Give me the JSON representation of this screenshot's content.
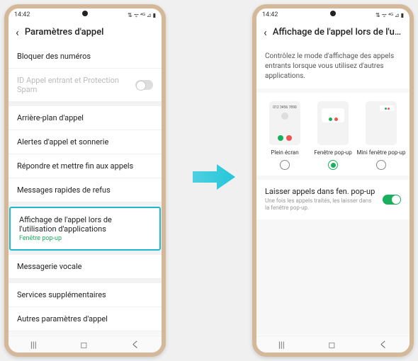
{
  "status": {
    "time": "14:42",
    "icons": "⚙ ◎ ✧ ⋯",
    "right": "⇅ ᯤ ⁴ᴳ  ⊿ ▮"
  },
  "left": {
    "title": "Paramètres d'appel",
    "items": {
      "block": "Bloquer des numéros",
      "caller_id": "ID Appel entrant et Protection Spam",
      "bg": "Arrière-plan d'appel",
      "alerts": "Alertes d'appel et sonnerie",
      "answer": "Répondre et mettre fin aux appels",
      "quick": "Messages rapides de refus",
      "display_title": "Affichage de l'appel lors de l'utilisation d'applications",
      "display_sub": "Fenêtre pop-up",
      "voicemail": "Messagerie vocale",
      "supp": "Services supplémentaires",
      "other": "Autres paramètres d'appel"
    }
  },
  "right": {
    "title": "Affichage de l'appel lors de l'utilisa...",
    "desc": "Contrôlez le mode d'affichage des appels entrants lorsque vous utilisez d'autres applications.",
    "preview_number": "012 3456 7890",
    "opts": {
      "full": "Plein écran",
      "popup": "Fenêtre pop-up",
      "mini": "Mini fenêtre pop-up"
    },
    "keep": {
      "title": "Laisser appels dans fen. pop-up",
      "sub": "Une fois les appels traités, les laisser dans la fenêtre pop-up."
    }
  }
}
